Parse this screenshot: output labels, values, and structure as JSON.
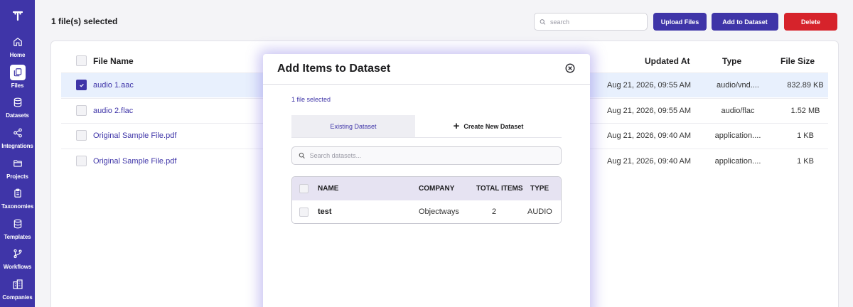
{
  "sidebar": {
    "logo": "T",
    "items": [
      {
        "label": "Home",
        "icon": "home-icon"
      },
      {
        "label": "Files",
        "icon": "files-icon",
        "active": true
      },
      {
        "label": "Datasets",
        "icon": "database-icon"
      },
      {
        "label": "Integrations",
        "icon": "share-icon"
      },
      {
        "label": "Projects",
        "icon": "folder-icon"
      },
      {
        "label": "Taxonomies",
        "icon": "clipboard-icon"
      },
      {
        "label": "Templates",
        "icon": "database-icon"
      },
      {
        "label": "Workflows",
        "icon": "git-branch-icon"
      },
      {
        "label": "Companies",
        "icon": "building-icon"
      }
    ]
  },
  "header": {
    "title": "1 file(s) selected",
    "search_placeholder": "search",
    "upload_label": "Upload Files",
    "add_label": "Add to Dataset",
    "delete_label": "Delete"
  },
  "table": {
    "columns": {
      "name": "File Name",
      "updated": "Updated At",
      "type": "Type",
      "size": "File Size"
    },
    "rows": [
      {
        "name": "audio 1.aac",
        "updated": "Aug 21, 2026, 09:55 AM",
        "type": "audio/vnd....",
        "size": "832.89 KB",
        "selected": true
      },
      {
        "name": "audio 2.flac",
        "updated": "Aug 21, 2026, 09:55 AM",
        "type": "audio/flac",
        "size": "1.52 MB",
        "selected": false
      },
      {
        "name": "Original Sample File.pdf",
        "updated": "Aug 21, 2026, 09:40 AM",
        "type": "application....",
        "size": "1 KB",
        "selected": false
      },
      {
        "name": "Original Sample File.pdf",
        "updated": "Aug 21, 2026, 09:40 AM",
        "type": "application....",
        "size": "1 KB",
        "selected": false
      }
    ]
  },
  "dialog": {
    "title": "Add Items to Dataset",
    "count_text": "1 file selected",
    "tab_existing": "Existing Dataset",
    "tab_create": "Create New Dataset",
    "search_placeholder": "Search datasets...",
    "columns": {
      "name": "NAME",
      "company": "COMPANY",
      "total": "TOTAL ITEMS",
      "type": "TYPE"
    },
    "rows": [
      {
        "name": "test",
        "company": "Objectways",
        "total": "2",
        "type": "AUDIO"
      }
    ]
  },
  "colors": {
    "primary": "#3f35a8",
    "danger": "#d6232b",
    "selected_row": "#e8f0fd"
  }
}
